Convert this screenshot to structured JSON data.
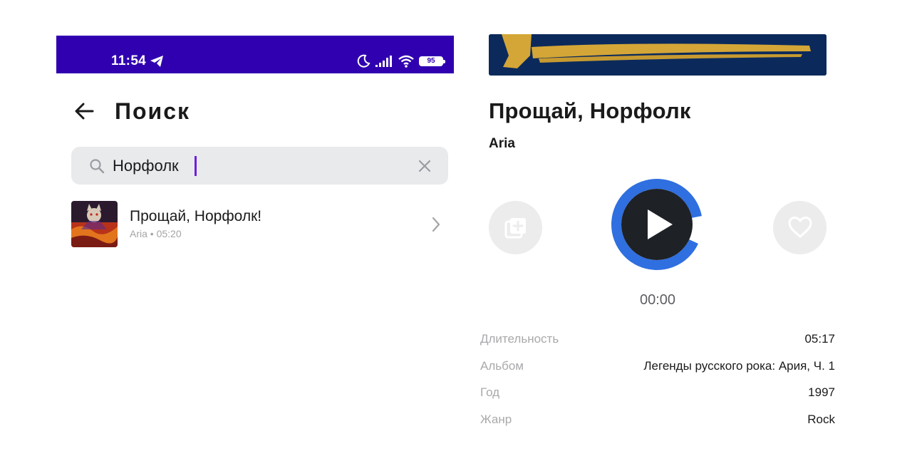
{
  "status_bar": {
    "time": "11:54",
    "battery": "95",
    "background": "#3000b0",
    "icons": [
      "telegram-icon",
      "moon-icon",
      "signal-icon",
      "wifi-icon",
      "battery-icon"
    ]
  },
  "search_screen": {
    "title": "Поиск",
    "search": {
      "value": "Норфолк",
      "placeholder": ""
    },
    "results": [
      {
        "title": "Прощай, Норфолк!",
        "artist": "Aria",
        "duration": "05:20",
        "meta": "Aria • 05:20"
      }
    ]
  },
  "track_screen": {
    "title": "Прощай, Норфолк",
    "artist": "Aria",
    "current_time": "00:00",
    "play_progress": 0.4,
    "accent_color": "#2f6fe0",
    "info": [
      {
        "label": "Длительность",
        "value": "05:17"
      },
      {
        "label": "Альбом",
        "value": "Легенды русского рока: Ария, Ч. 1"
      },
      {
        "label": "Год",
        "value": "1997"
      },
      {
        "label": "Жанр",
        "value": "Rock"
      }
    ]
  }
}
